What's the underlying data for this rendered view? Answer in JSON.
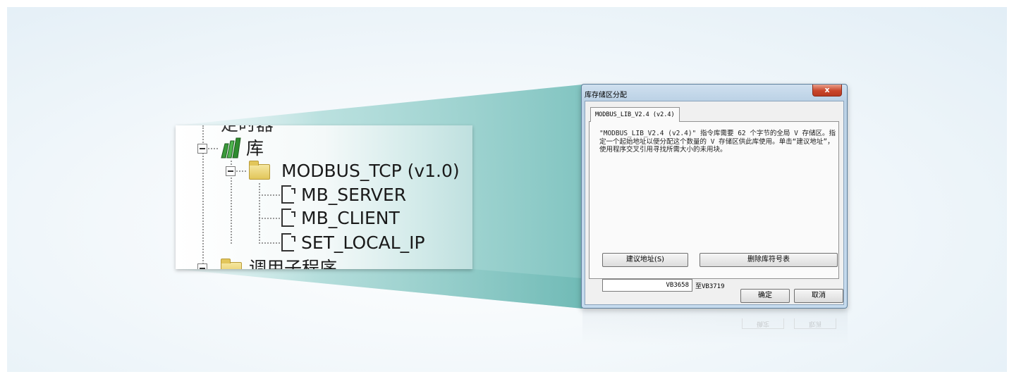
{
  "tree": {
    "top_partial_label": "定时器",
    "library_label": "库",
    "folder_label": "MODBUS_TCP (v1.0)",
    "items": [
      "MB_SERVER",
      "MB_CLIENT",
      "SET_LOCAL_IP"
    ],
    "bottom_partial_label": "调用子程序"
  },
  "dialog": {
    "title": "库存储区分配",
    "close_label": "x",
    "tab_label": "MODBUS_LIB_V2.4 (v2.4)",
    "description": "\"MODBUS_LIB_V2.4 (v2.4)\" 指令库需要 62 个字节的全局 V 存储区。指定一个起始地址以便分配这个数量的 V 存储区供此库使用。单击“建议地址”，使用程序交叉引用寻找所需大小的未用块。",
    "suggest_button": "建议地址(S)",
    "delete_button": "删除库符号表",
    "start_address": "VB3658",
    "end_address": "至VB3719",
    "ok_button": "确定",
    "cancel_button": "取消"
  },
  "colors": {
    "beam": "#8cc9c6",
    "dialog_frame": "#bcd2e6",
    "close_button": "#c9452a"
  }
}
